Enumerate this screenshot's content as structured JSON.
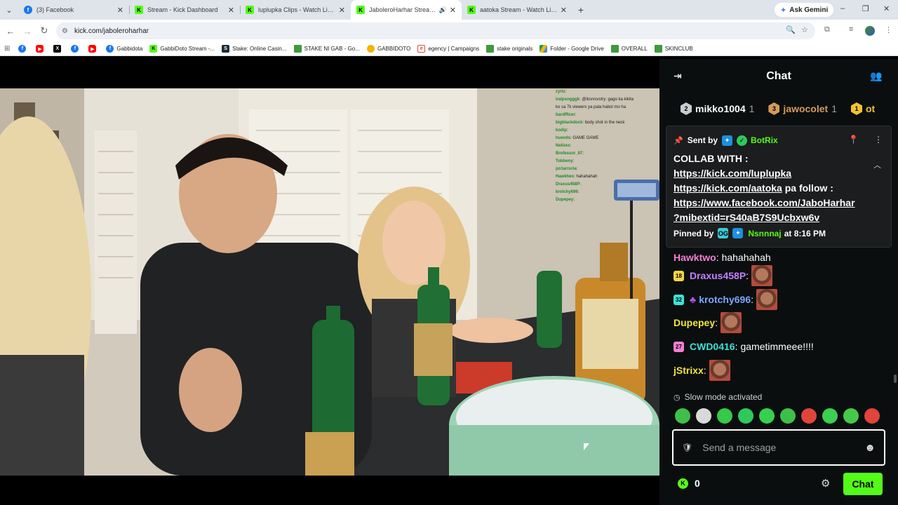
{
  "browser": {
    "tabs": [
      {
        "title": "(3) Facebook",
        "favicon": "facebook-icon"
      },
      {
        "title": "Stream - Kick Dashboard",
        "favicon": "kick-icon"
      },
      {
        "title": "luplupka Clips - Watch Live on Kick",
        "favicon": "kick-icon"
      },
      {
        "title": "JaboleroHarhar Stream - Watch Live on Kick",
        "favicon": "kick-icon",
        "active": true
      },
      {
        "title": "aatoka Stream - Watch Live on Kick",
        "favicon": "kick-icon"
      }
    ],
    "gemini_label": "Ask Gemini",
    "url": "kick.com/jaboleroharhar",
    "bookmarks": [
      {
        "label": "",
        "icon": "facebook-icon",
        "cls": "fb",
        "glyph": "f"
      },
      {
        "label": "",
        "icon": "youtube-icon",
        "cls": "yt",
        "glyph": "▶"
      },
      {
        "label": "",
        "icon": "x-icon",
        "cls": "x",
        "glyph": "X"
      },
      {
        "label": "",
        "icon": "facebook-icon",
        "cls": "fb",
        "glyph": "f"
      },
      {
        "label": "",
        "icon": "youtube-icon",
        "cls": "yt",
        "glyph": "▶"
      },
      {
        "label": "Gabbidota",
        "icon": "facebook-icon",
        "cls": "fb",
        "glyph": "f"
      },
      {
        "label": "GabbiDoto Stream -...",
        "icon": "kick-icon",
        "cls": "kick",
        "glyph": "K"
      },
      {
        "label": "Stake: Online Casin...",
        "icon": "stake-icon",
        "cls": "stake",
        "glyph": "S"
      },
      {
        "label": "STAKE NI GAB - Go...",
        "icon": "folder-icon",
        "cls": "folder",
        "glyph": ""
      },
      {
        "label": "GABBIDOTO",
        "icon": "gabbidoto-icon",
        "cls": "gab",
        "glyph": ""
      },
      {
        "label": "egency | Campaigns",
        "icon": "egency-icon",
        "cls": "eg",
        "glyph": "e"
      },
      {
        "label": "stake originals",
        "icon": "folder-icon",
        "cls": "folder",
        "glyph": ""
      },
      {
        "label": "Folder - Google Drive",
        "icon": "google-drive-icon",
        "cls": "drive",
        "glyph": ""
      },
      {
        "label": "OVERALL",
        "icon": "folder-icon",
        "cls": "folder",
        "glyph": ""
      },
      {
        "label": "SKINCLUB",
        "icon": "folder-icon",
        "cls": "folder",
        "glyph": ""
      }
    ]
  },
  "video_overlay_chat": [
    {
      "user": "zyrtz",
      "text": ""
    },
    {
      "user": "iralpsngggk",
      "text": "@ilovvsvstry: gago ka kikita"
    },
    {
      "user": "",
      "text": "ko sa 7k viewers ya pala habol mo ha"
    },
    {
      "user": "bardfficer",
      "text": ""
    },
    {
      "user": "bigblackdock",
      "text": "body shot in the neck"
    },
    {
      "user": "kodip",
      "text": ""
    },
    {
      "user": "huevds",
      "text": "GAME GAME"
    },
    {
      "user": "Nellzex",
      "text": ""
    },
    {
      "user": "Brofessor_87",
      "text": ""
    },
    {
      "user": "Tobbeny",
      "text": ""
    },
    {
      "user": "po1arruria",
      "text": ""
    },
    {
      "user": "Hawktwo",
      "text": "hahahahah"
    },
    {
      "user": "Draxus458P",
      "text": ""
    },
    {
      "user": "krotchy696",
      "text": ""
    },
    {
      "user": "Dupepey",
      "text": ""
    }
  ],
  "chat": {
    "title": "Chat",
    "leaderboard": [
      {
        "rank": "2",
        "name": "mikko1004",
        "count": "1",
        "color": "#c9ccd1"
      },
      {
        "rank": "3",
        "name": "jawocolet",
        "count": "1",
        "color": "#d49a5a"
      },
      {
        "rank": "1",
        "name": "ot",
        "count": "",
        "color": "#f2c230"
      }
    ],
    "pinned": {
      "sent_by_label": "Sent by",
      "sender": "BotRix",
      "lines": [
        {
          "text": "COLLAB WITH :",
          "link": false
        },
        {
          "text": "https://kick.com/luplupka",
          "link": true
        },
        {
          "text": "https://kick.com/aatoka",
          "link": true,
          "suffix": " pa follow :"
        },
        {
          "text": "https://www.facebook.com/JaboHarhar",
          "link": true
        },
        {
          "text": "?mibextid=rS40aB7S9Ucbxw6v",
          "link": true
        }
      ],
      "pinned_by_label": "Pinned by",
      "pinned_by": "Nsnnnaj",
      "pinned_time": "at 8:16 PM"
    },
    "messages": [
      {
        "user": "Hawktwo",
        "color": "#f27fd3",
        "text": "hahahahah",
        "badge": "",
        "badge_color": "",
        "emote": false,
        "extra_icon": false
      },
      {
        "user": "Draxus458P",
        "color": "#c77dff",
        "text": "",
        "badge": "18",
        "badge_color": "#f5d442",
        "emote": true,
        "extra_icon": false
      },
      {
        "user": "krotchy696",
        "color": "#7aa7ff",
        "text": "",
        "badge": "32",
        "badge_color": "#3ee0d8",
        "emote": true,
        "extra_icon": true
      },
      {
        "user": "Dupepey",
        "color": "#f2e43a",
        "text": "",
        "badge": "",
        "badge_color": "",
        "emote": true,
        "extra_icon": false
      },
      {
        "user": "CWD0416",
        "color": "#3ee0d8",
        "text": "gametimmeee!!!!",
        "badge": "27",
        "badge_color": "#f27fd3",
        "emote": false,
        "extra_icon": false
      },
      {
        "user": "jStrixx",
        "color": "#f2e43a",
        "text": "",
        "badge": "",
        "badge_color": "",
        "emote": true,
        "extra_icon": false
      }
    ],
    "slow_mode": "Slow mode activated",
    "emotes": [
      "#3fbf4a",
      "#d9d9d9",
      "#36c94a",
      "#2fc95b",
      "#35d14e",
      "#3fbf4a",
      "#e0443a",
      "#3ccf52",
      "#46c94a",
      "#e0443a"
    ],
    "input_placeholder": "Send a message",
    "points": "0",
    "send_label": "Chat"
  }
}
